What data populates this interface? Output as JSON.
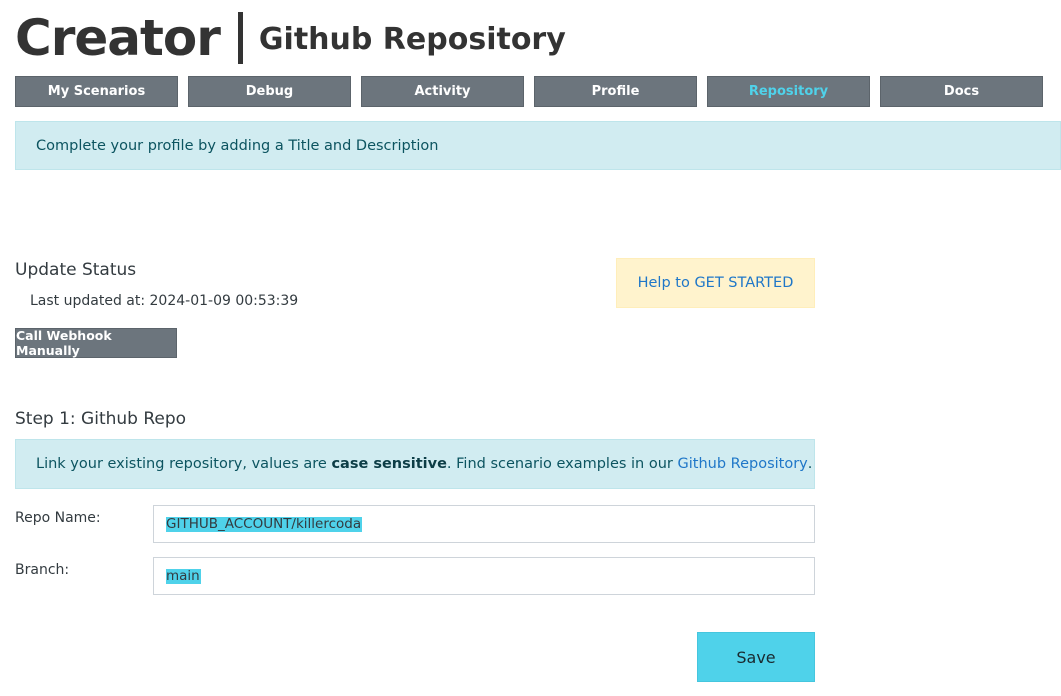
{
  "header": {
    "brand": "Creator",
    "subtitle": "Github Repository"
  },
  "nav": {
    "tabs": [
      {
        "label": "My Scenarios",
        "active": false
      },
      {
        "label": "Debug",
        "active": false
      },
      {
        "label": "Activity",
        "active": false
      },
      {
        "label": "Profile",
        "active": false
      },
      {
        "label": "Repository",
        "active": true
      },
      {
        "label": "Docs",
        "active": false
      }
    ]
  },
  "profile_alert": {
    "text": "Complete your profile by adding a Title and Description"
  },
  "update_status": {
    "title": "Update Status",
    "last_updated_label": "Last updated at:",
    "last_updated_value": "2024-01-09 00:53:39",
    "webhook_button": "Call Webhook Manually",
    "help_link": "Help to GET STARTED"
  },
  "step1": {
    "title": "Step 1: Github Repo",
    "info_prefix": "Link your existing repository, values are ",
    "info_bold": "case sensitive",
    "info_middle": ". Find scenario examples in our ",
    "info_link": "Github Repository",
    "info_suffix": ".",
    "repo_label": "Repo Name:",
    "repo_value": "GITHUB_ACCOUNT/killercoda",
    "branch_label": "Branch:",
    "branch_value": "main",
    "save_button": "Save"
  },
  "colors": {
    "tab_bg": "#6c757d",
    "active_tab_text": "#4fd2ea",
    "info_bg": "#d1ecf1",
    "help_bg": "#fff3cd",
    "link": "#1f77c8",
    "save_bg": "#4fd2ea",
    "highlight": "#4fd2ea"
  }
}
